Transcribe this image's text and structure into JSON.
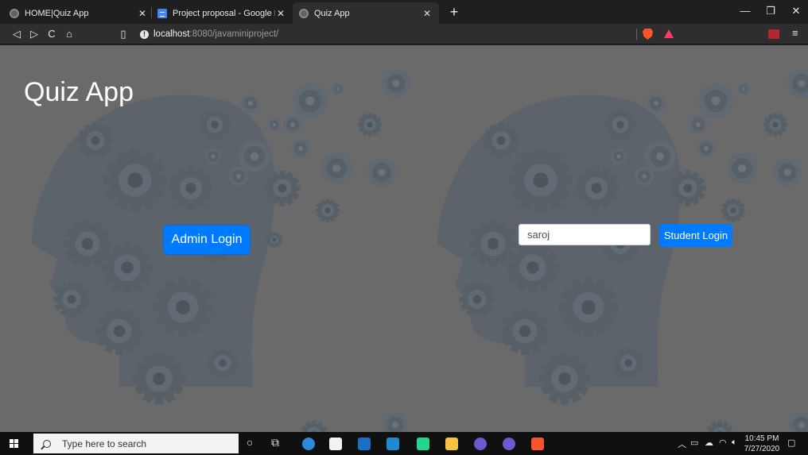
{
  "browser": {
    "tabs": [
      {
        "title": "HOME|Quiz App",
        "active": false
      },
      {
        "title": "Project proposal - Google Docs",
        "active": false
      },
      {
        "title": "Quiz App",
        "active": true
      }
    ],
    "new_tab": "+",
    "url_host": "localhost",
    "url_path": ":8080/javaminiproject/",
    "window_controls": {
      "minimize": "—",
      "restore": "❐",
      "close": "✕"
    }
  },
  "page": {
    "title": "Quiz App",
    "admin_button": "Admin Login",
    "username_value": "saroj",
    "student_button": "Student Login",
    "colors": {
      "button": "#007bff",
      "overlay": "#696969",
      "gear": "#3d4f61"
    }
  },
  "taskbar": {
    "search_placeholder": "Type here to search",
    "time": "10:45 PM",
    "date": "7/27/2020",
    "icons": [
      "windows-start-icon",
      "cortana-icon",
      "task-view-icon",
      "edge-icon",
      "store-icon",
      "mail-icon",
      "vscode-icon",
      "pycharm-icon",
      "file-explorer-icon",
      "eclipse-icon",
      "eclipse-icon-2",
      "brave-icon"
    ]
  }
}
